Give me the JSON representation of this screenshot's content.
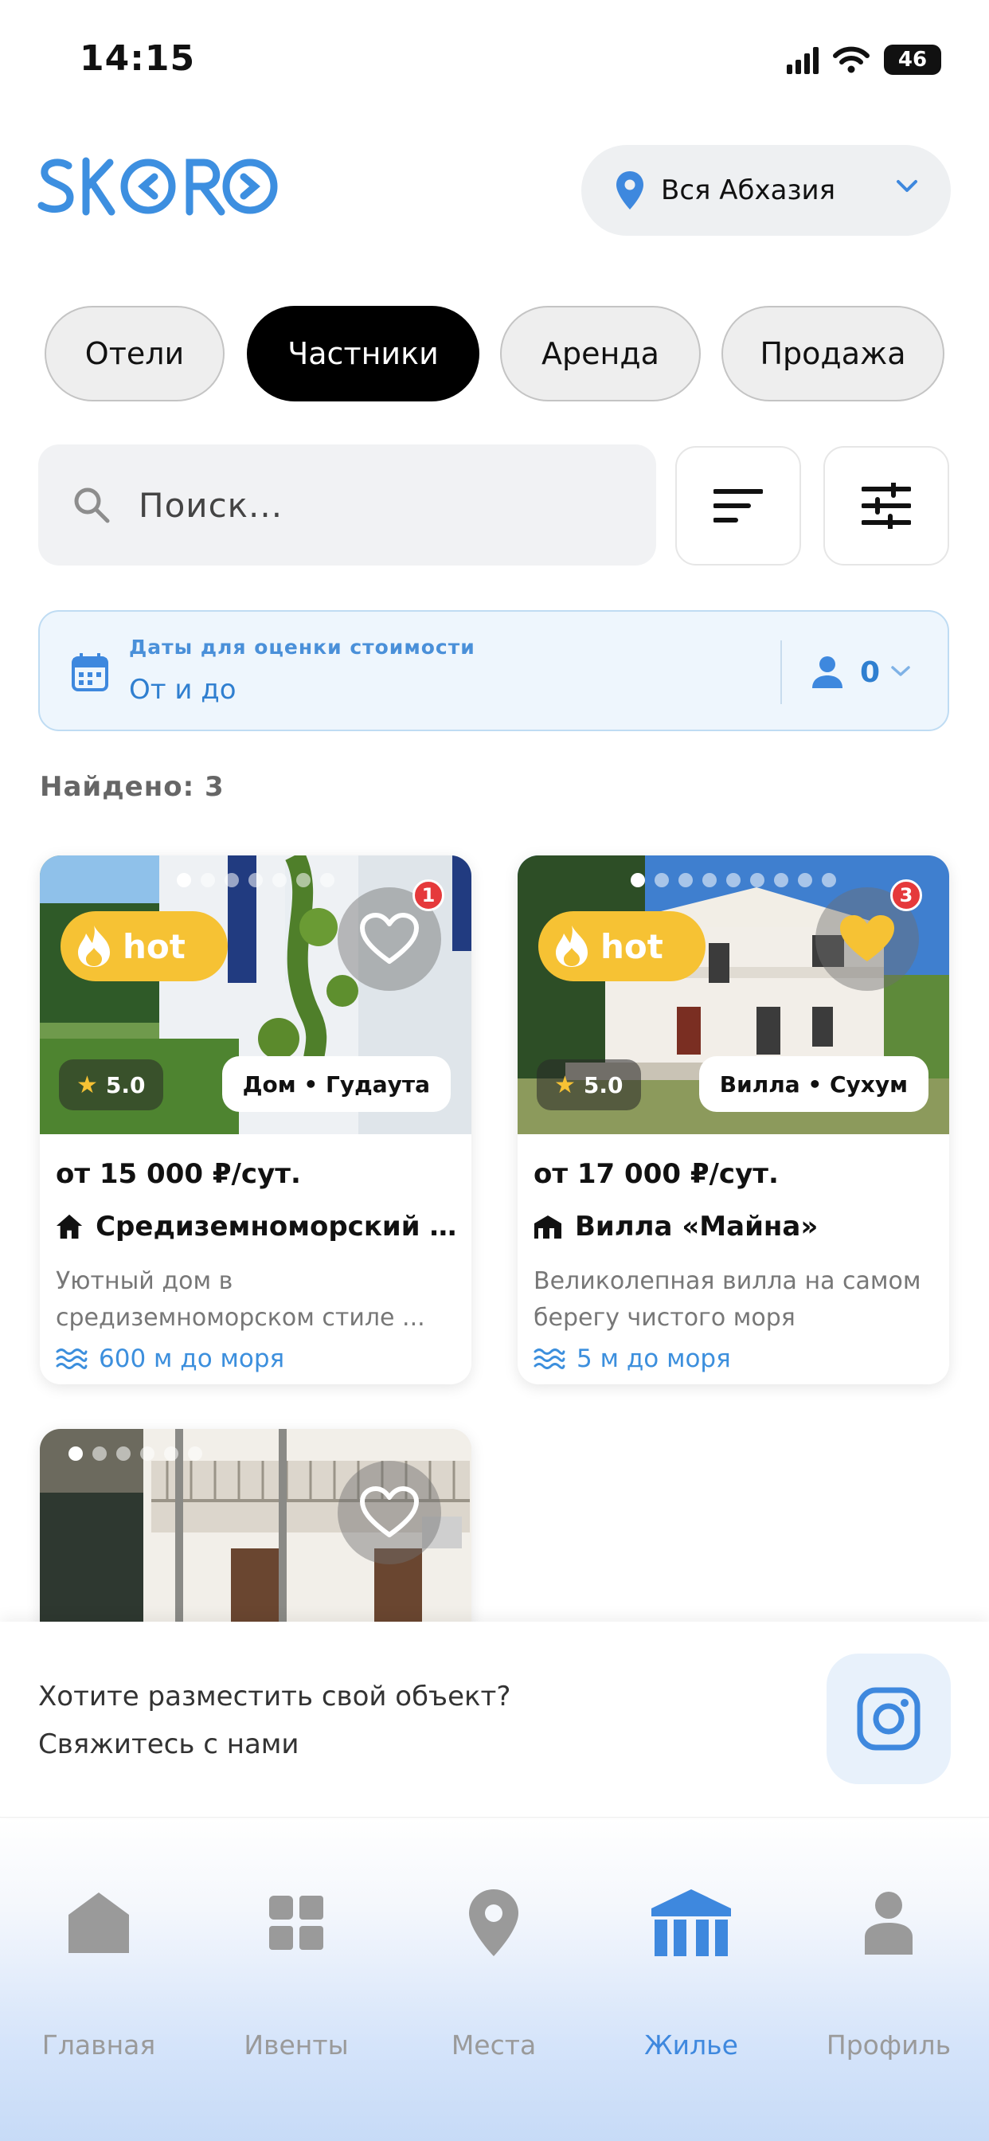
{
  "status_bar": {
    "time": "14:15",
    "battery": "46"
  },
  "header": {
    "logo": "SKORO",
    "region": "Вся Абхазия"
  },
  "categories": [
    {
      "label": "Отели",
      "active": false
    },
    {
      "label": "Частники",
      "active": true
    },
    {
      "label": "Аренда",
      "active": false
    },
    {
      "label": "Продажа",
      "active": false
    }
  ],
  "search": {
    "placeholder": "Поиск..."
  },
  "dates": {
    "label": "Даты для оценки стоимости",
    "value": "От и до",
    "guests": "0"
  },
  "found": "Найдено: 3",
  "listings": [
    {
      "hot": "hot",
      "favorite_count": "1",
      "favorited": false,
      "rating": "5.0",
      "type_location": "Дом • Гудаута",
      "price": "от 15 000 ₽/сут.",
      "name": "Средиземноморский д...",
      "description": "Уютный дом в средиземноморском стиле ...",
      "sea_distance": "600 м до моря"
    },
    {
      "hot": "hot",
      "favorite_count": "3",
      "favorited": true,
      "rating": "5.0",
      "type_location": "Вилла • Сухум",
      "price": "от 17 000 ₽/сут.",
      "name": "Вилла «Майна»",
      "description": "Великолепная вилла на самом берегу чистого моря",
      "sea_distance": "5 м до моря"
    }
  ],
  "contact": {
    "line1": "Хотите разместить свой объект?",
    "line2": "Свяжитесь с нами"
  },
  "tabs": [
    {
      "label": "Главная",
      "icon": "home-icon",
      "active": false
    },
    {
      "label": "Ивенты",
      "icon": "grid-icon",
      "active": false
    },
    {
      "label": "Места",
      "icon": "map-pin-icon",
      "active": false
    },
    {
      "label": "Жилье",
      "icon": "building-icon",
      "active": true
    },
    {
      "label": "Профиль",
      "icon": "user-icon",
      "active": false
    }
  ],
  "colors": {
    "accent": "#3e88de",
    "hot": "#f6c234",
    "badge": "#e5393b",
    "active_chip": "#000000"
  }
}
